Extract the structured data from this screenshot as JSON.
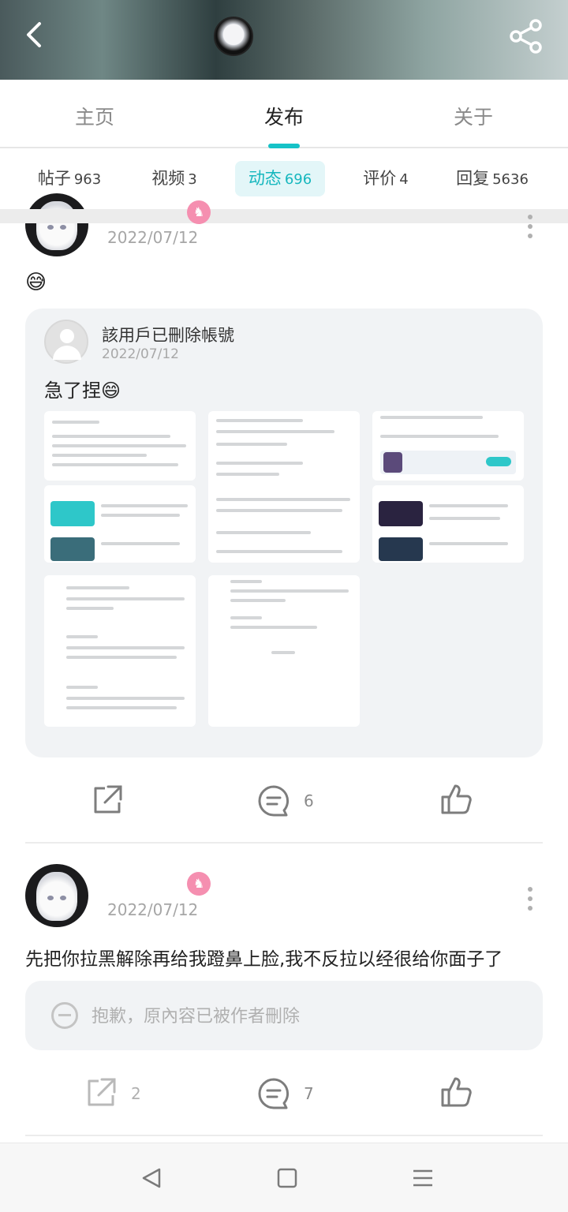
{
  "header": {
    "back_icon": "chevron-left-icon",
    "share_icon": "share-icon"
  },
  "tabs": [
    {
      "label": "主页"
    },
    {
      "label": "发布"
    },
    {
      "label": "关于"
    }
  ],
  "subtabs": [
    {
      "label": "帖子",
      "count": "963"
    },
    {
      "label": "视频",
      "count": "3"
    },
    {
      "label": "动态",
      "count": "696"
    },
    {
      "label": "评价",
      "count": "4"
    },
    {
      "label": "回复",
      "count": "5636"
    }
  ],
  "post1": {
    "date": "2022/07/12",
    "emoji": "😅",
    "repost": {
      "author": "該用戶已刪除帳號",
      "date": "2022/07/12",
      "text": "急了捏😄"
    },
    "comments": "6"
  },
  "post2": {
    "date": "2022/07/12",
    "text": "先把你拉黑解除再给我蹬鼻上脸,我不反拉以经很给你面子了",
    "deleted_notice": "抱歉，原內容已被作者刪除",
    "shares": "2",
    "comments": "7"
  },
  "colors": {
    "accent": "#16c2c7",
    "badge": "#f58fb0"
  }
}
